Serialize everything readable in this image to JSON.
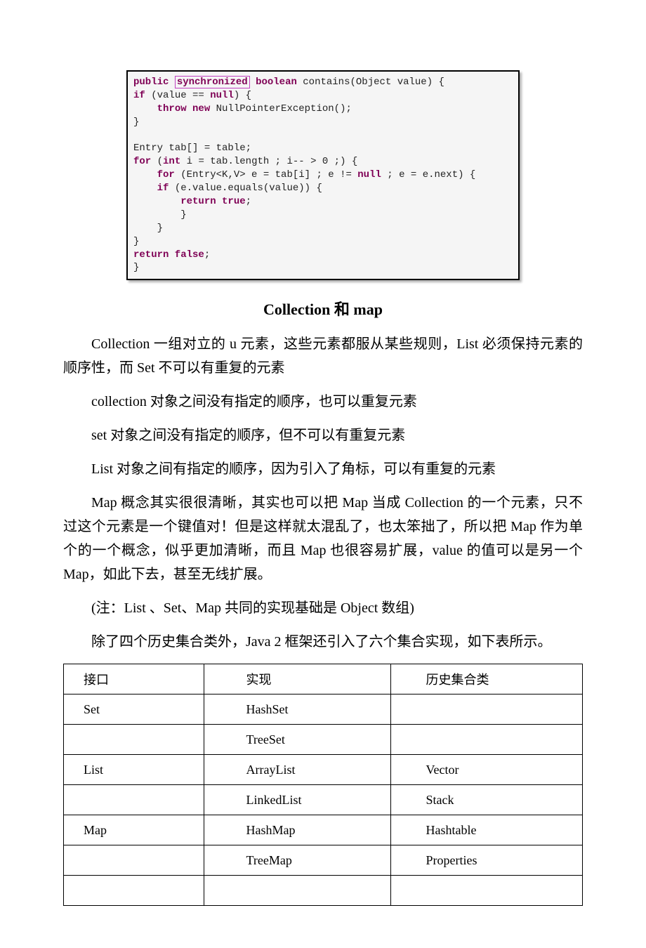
{
  "code": {
    "line1a": "public",
    "line1b": "synchronized",
    "line1c": "boolean",
    "line1d": " contains(Object value) {",
    "line2a": "if",
    "line2b": " (value == ",
    "line2c": "null",
    "line2d": ") {",
    "line3a": "throw new",
    "line3b": " NullPointerException();",
    "line4": "}",
    "line5": "",
    "line6": "Entry tab[] = table;",
    "line7a": "for",
    "line7b": " (",
    "line7c": "int",
    "line7d": " i = tab.length ; i-- > 0 ;) {",
    "line8a": "for",
    "line8b": " (Entry<K,V> e = tab[i] ; e != ",
    "line8c": "null",
    "line8d": " ; e = e.next) {",
    "line9a": "if",
    "line9b": " (e.value.equals(value)) {",
    "line10a": "return true",
    "line10b": ";",
    "line11": "        }",
    "line12": "    }",
    "line13": "}",
    "line14a": "return false",
    "line14b": ";",
    "line15": "}"
  },
  "heading": "Collection 和 map",
  "paragraphs": {
    "p1": "Collection 一组对立的 u 元素，这些元素都服从某些规则，List 必须保持元素的顺序性，而 Set 不可以有重复的元素",
    "p2": "collection 对象之间没有指定的顺序，也可以重复元素",
    "p3": "set 对象之间没有指定的顺序，但不可以有重复元素",
    "p4": "List 对象之间有指定的顺序，因为引入了角标，可以有重复的元素",
    "p5": "Map 概念其实很很清晰，其实也可以把 Map 当成 Collection 的一个元素，只不过这个元素是一个键值对！但是这样就太混乱了，也太笨拙了，所以把 Map 作为单个的一个概念，似乎更加清晰，而且 Map 也很容易扩展，value 的值可以是另一个 Map，如此下去，甚至无线扩展。",
    "p6": "(注：List 、Set、Map 共同的实现基础是 Object 数组)",
    "p7": "除了四个历史集合类外，Java 2 框架还引入了六个集合实现，如下表所示。"
  },
  "table": {
    "header": {
      "c1": "接口",
      "c2": "实现",
      "c3": "历史集合类"
    },
    "rows": [
      {
        "c1": "Set",
        "c2": "HashSet",
        "c3": ""
      },
      {
        "c1": "",
        "c2": "TreeSet",
        "c3": ""
      },
      {
        "c1": "List",
        "c2": "ArrayList",
        "c3": "Vector"
      },
      {
        "c1": "",
        "c2": "LinkedList",
        "c3": "Stack"
      },
      {
        "c1": "Map",
        "c2": "HashMap",
        "c3": "Hashtable"
      },
      {
        "c1": "",
        "c2": "TreeMap",
        "c3": "Properties"
      },
      {
        "c1": "",
        "c2": "",
        "c3": ""
      }
    ]
  }
}
